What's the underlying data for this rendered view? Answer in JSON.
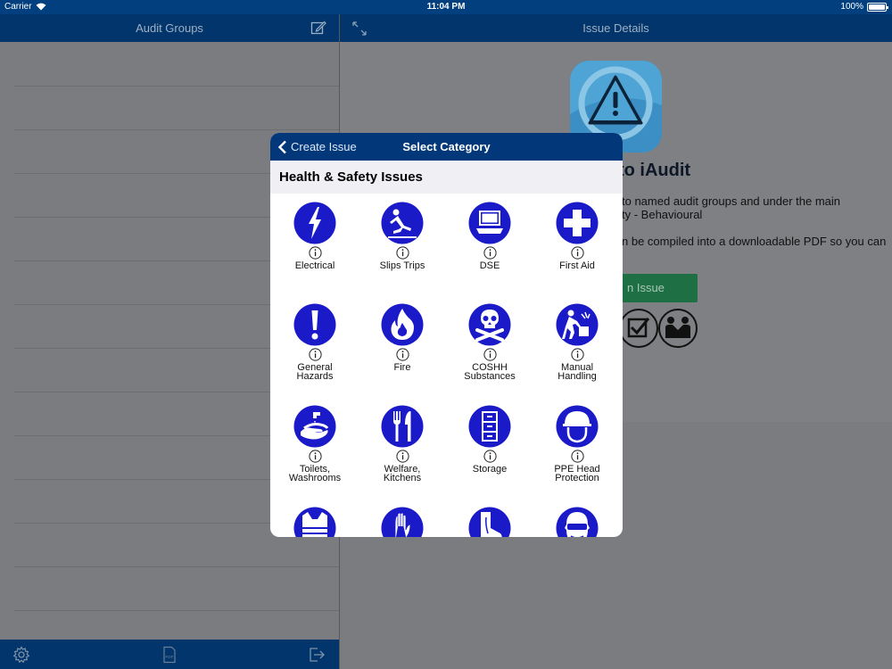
{
  "status_bar": {
    "carrier": "Carrier",
    "time": "11:04 PM",
    "battery": "100%"
  },
  "left_pane": {
    "title": "Audit Groups",
    "toolbar": {
      "settings_icon": "gear-icon",
      "pdf_icon": "pdf-icon",
      "logout_icon": "logout-icon",
      "pdf_label": "PDF"
    }
  },
  "right_pane": {
    "title": "Issue Details",
    "welcome_visible": "to iAudit",
    "description_lines": [
      "to named audit groups and under the main",
      "ty - Behavioural",
      "n be compiled into a downloadable PDF so you can"
    ],
    "button_visible": "n Issue"
  },
  "modal": {
    "back_label": "Create Issue",
    "title": "Select Category",
    "section_header": "Health & Safety Issues",
    "categories": [
      {
        "label": "Electrical",
        "icon": "lightning-icon"
      },
      {
        "label": "Slips Trips",
        "icon": "slip-icon"
      },
      {
        "label": "DSE",
        "icon": "computer-icon"
      },
      {
        "label": "First Aid",
        "icon": "first-aid-cross-icon"
      },
      {
        "label": "General\nHazards",
        "icon": "exclamation-icon"
      },
      {
        "label": "Fire",
        "icon": "flame-icon"
      },
      {
        "label": "COSHH\nSubstances",
        "icon": "skull-crossbones-icon"
      },
      {
        "label": "Manual\nHandling",
        "icon": "lifting-box-icon"
      },
      {
        "label": "Toilets,\nWashrooms",
        "icon": "hand-wash-icon"
      },
      {
        "label": "Welfare,\nKitchens",
        "icon": "knife-fork-icon"
      },
      {
        "label": "Storage",
        "icon": "filing-cabinet-icon"
      },
      {
        "label": "PPE Head\nProtection",
        "icon": "hard-hat-icon"
      },
      {
        "label": "",
        "icon": "hi-vis-vest-icon"
      },
      {
        "label": "",
        "icon": "gloves-icon"
      },
      {
        "label": "",
        "icon": "safety-boot-icon"
      },
      {
        "label": "",
        "icon": "safety-goggles-icon"
      }
    ]
  },
  "colors": {
    "nav_blue": "#01356b",
    "icon_blue": "#1a1ac8",
    "green": "#1f6f45"
  }
}
